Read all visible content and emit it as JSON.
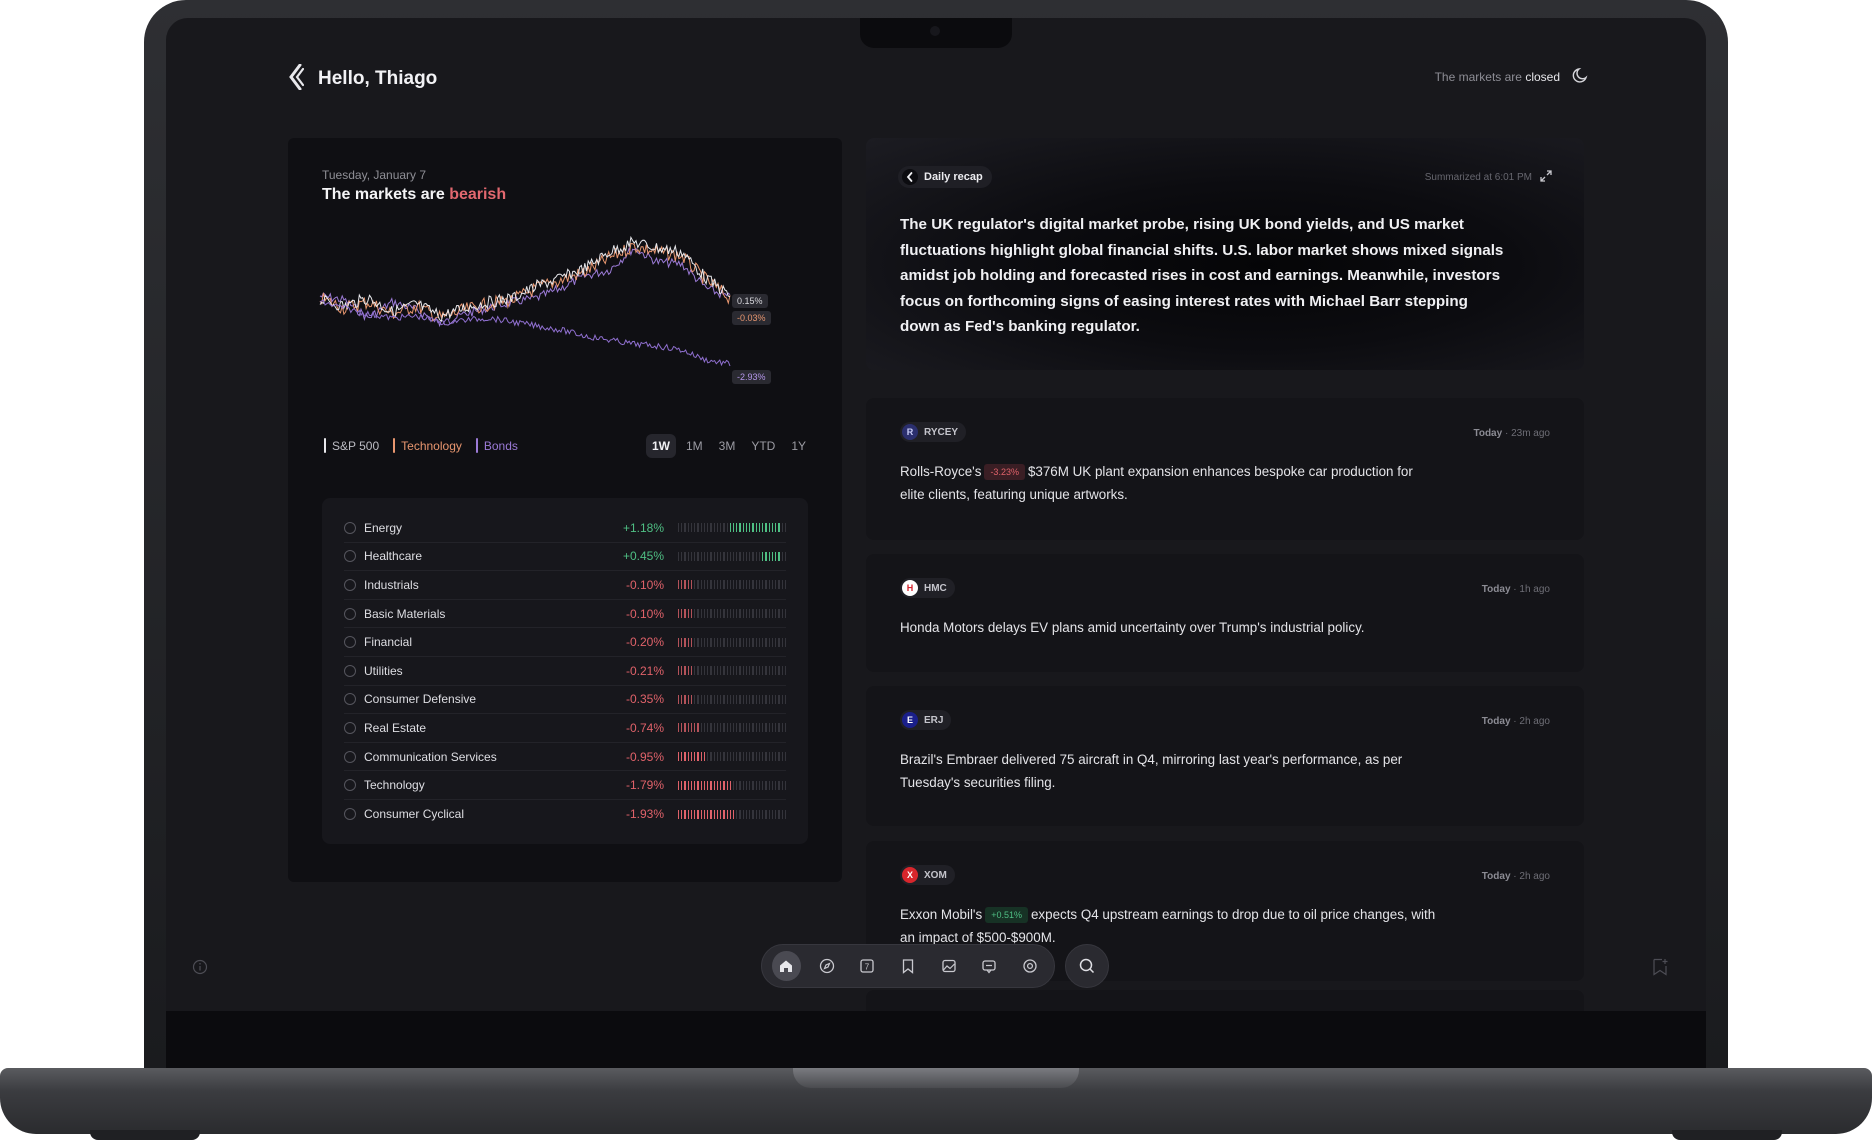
{
  "header": {
    "greeting": "Hello, Thiago",
    "status_prefix": "The markets are",
    "status_value": "closed"
  },
  "market": {
    "date": "Tuesday, January 7",
    "headline_prefix": "The markets are",
    "headline_sentiment": "bearish",
    "legend": [
      {
        "label": "S&P 500",
        "color": "#e8e8ec"
      },
      {
        "label": "Technology",
        "color": "#e8966f"
      },
      {
        "label": "Bonds",
        "color": "#9b7ad6"
      }
    ],
    "ranges": [
      "1W",
      "1M",
      "3M",
      "YTD",
      "1Y"
    ],
    "active_range": "1W",
    "chart_labels": {
      "sp500": "0.15%",
      "tech": "-0.03%",
      "bonds": "-2.93%"
    }
  },
  "sectors": [
    {
      "name": "Energy",
      "change": "+1.18%",
      "value": 1.18
    },
    {
      "name": "Healthcare",
      "change": "+0.45%",
      "value": 0.45
    },
    {
      "name": "Industrials",
      "change": "-0.10%",
      "value": -0.1
    },
    {
      "name": "Basic Materials",
      "change": "-0.10%",
      "value": -0.1
    },
    {
      "name": "Financial",
      "change": "-0.20%",
      "value": -0.2
    },
    {
      "name": "Utilities",
      "change": "-0.21%",
      "value": -0.21
    },
    {
      "name": "Consumer Defensive",
      "change": "-0.35%",
      "value": -0.35
    },
    {
      "name": "Real Estate",
      "change": "-0.74%",
      "value": -0.74
    },
    {
      "name": "Communication Services",
      "change": "-0.95%",
      "value": -0.95
    },
    {
      "name": "Technology",
      "change": "-1.79%",
      "value": -1.79
    },
    {
      "name": "Consumer Cyclical",
      "change": "-1.93%",
      "value": -1.93
    }
  ],
  "recap": {
    "tag": "Daily recap",
    "time": "Summarized at 6:01 PM",
    "text": "The UK regulator's digital market probe, rising UK bond yields, and US market fluctuations highlight global financial shifts. U.S. labor market shows mixed signals amidst job holding and forecasted rises in cost and earnings. Meanwhile, investors focus on forthcoming signs of easing interest rates with Michael Barr stepping down as Fed's banking regulator."
  },
  "news": [
    {
      "ticker": "RYCEY",
      "day": "Today",
      "ago": "23m ago",
      "lead": "Rolls-Royce's",
      "pill": "-3.23%",
      "pill_type": "neg",
      "text": "$376M UK plant expansion enhances bespoke car production for elite clients, featuring unique artworks.",
      "logo_bg": "#2b2f6e",
      "logo_fg": "#c9cdf7",
      "logo_glyph": "R"
    },
    {
      "ticker": "HMC",
      "day": "Today",
      "ago": "1h ago",
      "lead": "",
      "pill": "",
      "pill_type": "",
      "text": "Honda Motors delays EV plans amid uncertainty over Trump's industrial policy.",
      "logo_bg": "#ffffff",
      "logo_fg": "#d4212b",
      "logo_glyph": "H"
    },
    {
      "ticker": "ERJ",
      "day": "Today",
      "ago": "2h ago",
      "lead": "",
      "pill": "",
      "pill_type": "",
      "text": "Brazil's Embraer delivered 75 aircraft in Q4, mirroring last year's performance, as per Tuesday's securities filing.",
      "logo_bg": "#1a1f8a",
      "logo_fg": "#ffffff",
      "logo_glyph": "E"
    },
    {
      "ticker": "XOM",
      "day": "Today",
      "ago": "2h ago",
      "lead": "Exxon Mobil's",
      "pill": "+0.51%",
      "pill_type": "pos",
      "text": "expects Q4 upstream earnings to drop due to oil price changes, with an impact of $500-$900M.",
      "logo_bg": "#d8262c",
      "logo_fg": "#ffffff",
      "logo_glyph": "X"
    }
  ],
  "dock": [
    "home-icon",
    "compass-icon",
    "calendar-icon",
    "bookmark-icon",
    "image-icon",
    "chat-icon",
    "settings-icon"
  ],
  "colors": {
    "accent_red": "#e0626a",
    "accent_green": "#4fbf84",
    "bonds": "#9b7ad6",
    "tech": "#e8966f"
  }
}
